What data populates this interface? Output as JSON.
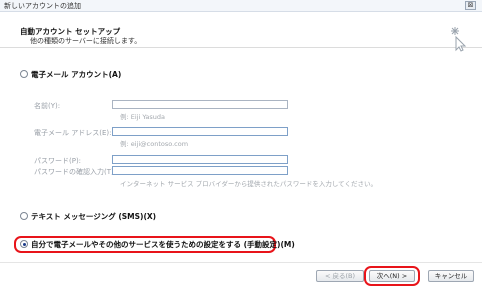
{
  "window": {
    "title": "新しいアカウントの追加",
    "close_glyph": "⊠"
  },
  "header": {
    "title": "自動アカウント セットアップ",
    "subtitle": "他の種類のサーバーに接続します。"
  },
  "options": {
    "email_account": "電子メール アカウント(A)",
    "sms": "テキスト メッセージング (SMS)(X)",
    "manual": "自分で電子メールやその他のサービスを使うための設定をする (手動設定)(M)"
  },
  "form": {
    "name_label": "名前(Y):",
    "name_hint": "例: Eiji Yasuda",
    "email_label": "電子メール アドレス(E):",
    "email_hint": "例: eiji@contoso.com",
    "password_label": "パスワード(P):",
    "confirm_label": "パスワードの確認入力(T):",
    "password_hint": "インターネット サービス プロバイダーから提供されたパスワードを入力してください。"
  },
  "buttons": {
    "back": "< 戻る(B)",
    "next": "次へ(N) >",
    "cancel": "キャンセル"
  },
  "colors": {
    "highlight": "#e8141a",
    "selected_radio": "#1e3d8a"
  },
  "icons": {
    "wizard": "wizard-sparkle-icon"
  }
}
